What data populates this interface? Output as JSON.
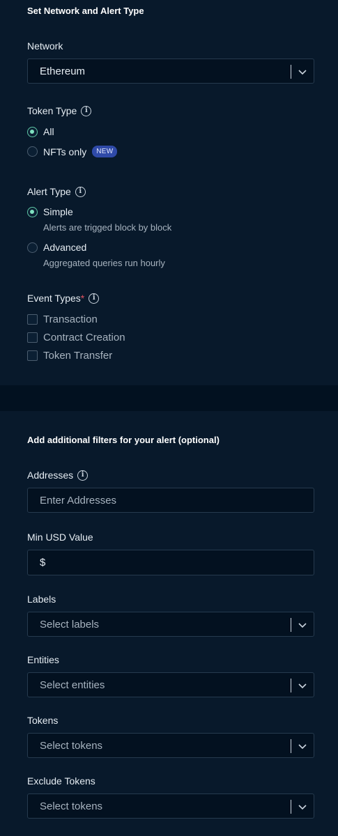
{
  "section1": {
    "title": "Set Network and Alert Type",
    "network": {
      "label": "Network",
      "value": "Ethereum"
    },
    "token_type": {
      "label": "Token Type",
      "options": [
        {
          "label": "All",
          "selected": true
        },
        {
          "label": "NFTs only",
          "selected": false,
          "badge": "NEW"
        }
      ]
    },
    "alert_type": {
      "label": "Alert Type",
      "options": [
        {
          "label": "Simple",
          "description": "Alerts are trigged block by block",
          "selected": true
        },
        {
          "label": "Advanced",
          "description": "Aggregated queries run hourly",
          "selected": false
        }
      ]
    },
    "event_types": {
      "label": "Event Types",
      "required_mark": "*",
      "options": [
        {
          "label": "Transaction",
          "checked": false
        },
        {
          "label": "Contract Creation",
          "checked": false
        },
        {
          "label": "Token Transfer",
          "checked": false
        }
      ]
    }
  },
  "section2": {
    "title": "Add additional filters for your alert (optional)",
    "addresses": {
      "label": "Addresses",
      "placeholder": "Enter Addresses"
    },
    "min_usd": {
      "label": "Min USD Value",
      "prefix": "$"
    },
    "labels": {
      "label": "Labels",
      "placeholder": "Select labels"
    },
    "entities": {
      "label": "Entities",
      "placeholder": "Select entities"
    },
    "tokens": {
      "label": "Tokens",
      "placeholder": "Select tokens"
    },
    "exclude_tokens": {
      "label": "Exclude Tokens",
      "placeholder": "Select tokens"
    }
  },
  "icons": [
    "info-icon",
    "chevron-down-icon"
  ],
  "colors": {
    "accent": "#5fc7a4",
    "badge": "#2f4aa8",
    "required": "#e05260"
  }
}
